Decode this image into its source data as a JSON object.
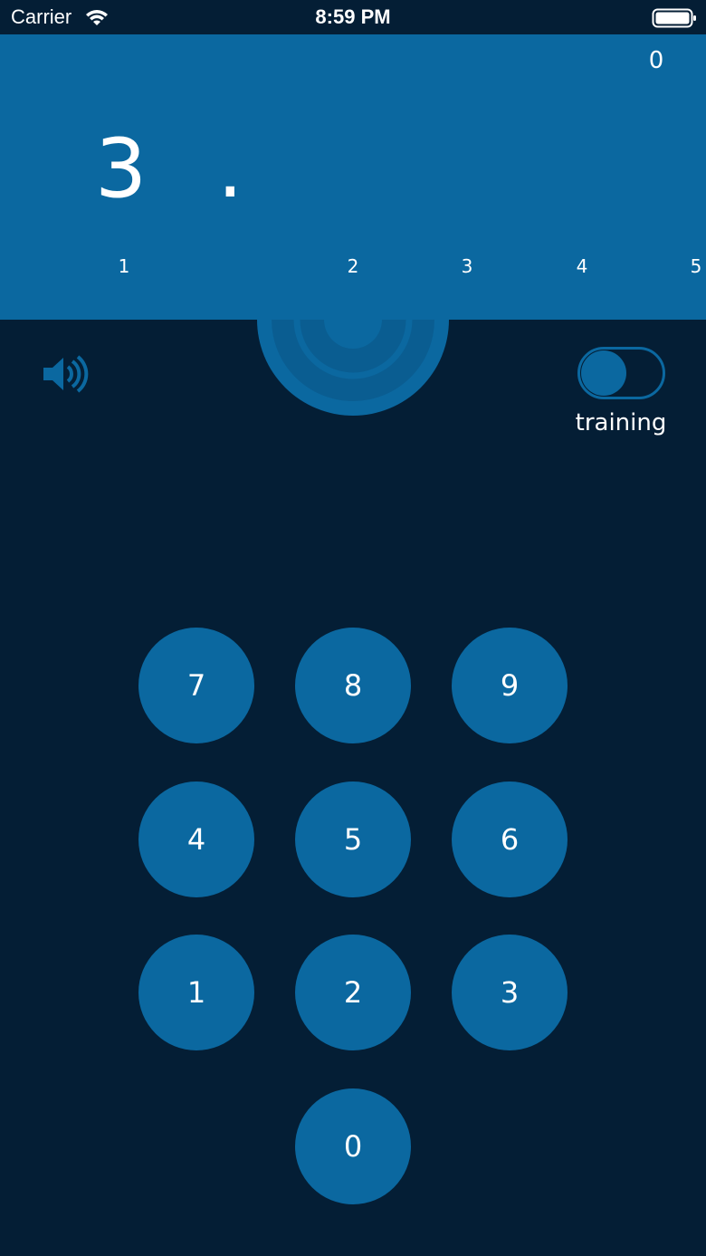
{
  "status_bar": {
    "carrier": "Carrier",
    "time": "8:59 PM"
  },
  "display": {
    "score": "0",
    "digits": [
      "3",
      "."
    ],
    "positions": [
      "1",
      "2",
      "3",
      "4",
      "5"
    ]
  },
  "controls": {
    "sound_icon": "speaker-icon",
    "training_label": "training",
    "training_on": false
  },
  "keypad": {
    "keys": [
      "7",
      "8",
      "9",
      "4",
      "5",
      "6",
      "1",
      "2",
      "3",
      "0"
    ]
  },
  "colors": {
    "background": "#041e35",
    "accent": "#0b68a0"
  }
}
